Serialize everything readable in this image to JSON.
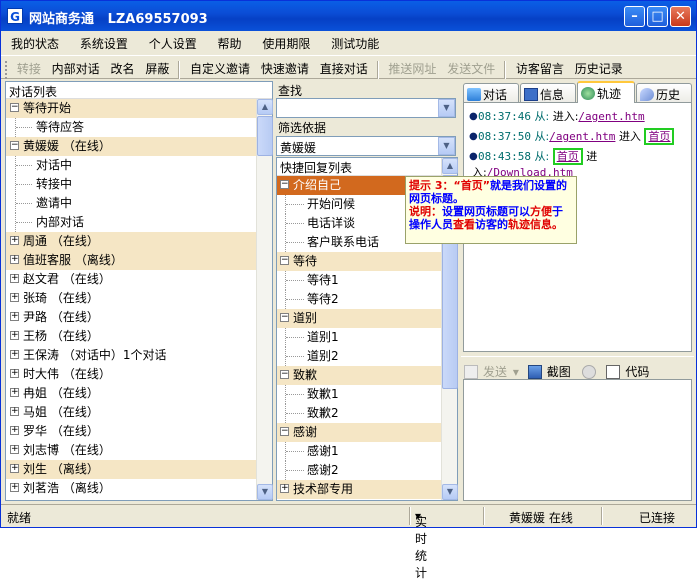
{
  "window": {
    "app_icon": "G",
    "title": "网站商务通   LZA69557093",
    "minimize_icon": "minimize-icon",
    "maximize_icon": "maximize-icon",
    "close_icon": "close-icon"
  },
  "menu": [
    "我的状态",
    "系统设置",
    "个人设置",
    "帮助",
    "使用期限",
    "测试功能"
  ],
  "toolbar": {
    "transfer": "转接",
    "internal_chat": "内部对话",
    "rename": "改名",
    "block": "屏蔽",
    "custom_invite": "自定义邀请",
    "quick_invite": "快速邀请",
    "direct_chat": "直接对话",
    "push_url": "推送网址",
    "send_file": "发送文件",
    "visitor_message": "访客留言",
    "history": "历史记录"
  },
  "left": {
    "header": "对话列表",
    "items": [
      {
        "label": "等待开始",
        "type": "group",
        "hl": true
      },
      {
        "label": "等待应答",
        "type": "child",
        "hl": false
      },
      {
        "label": "黄媛媛 （在线）",
        "type": "group",
        "hl": true
      },
      {
        "label": "对话中",
        "type": "child",
        "hl": false
      },
      {
        "label": "转接中",
        "type": "child",
        "hl": false
      },
      {
        "label": "邀请中",
        "type": "child",
        "hl": false
      },
      {
        "label": "内部对话",
        "type": "child",
        "hl": false
      },
      {
        "label": "周通 （在线）",
        "type": "group",
        "hl": true
      },
      {
        "label": "值班客服 （离线）",
        "type": "group",
        "hl": true
      },
      {
        "label": "赵文君 （在线）",
        "type": "group",
        "hl": false
      },
      {
        "label": "张琦 （在线）",
        "type": "group",
        "hl": false
      },
      {
        "label": "尹路 （在线）",
        "type": "group",
        "hl": false
      },
      {
        "label": "王杨 （在线）",
        "type": "group",
        "hl": false
      },
      {
        "label": "王保涛 （对话中）1个对话",
        "type": "group",
        "hl": false
      },
      {
        "label": "时大伟 （在线）",
        "type": "group",
        "hl": false
      },
      {
        "label": "冉姐 （在线）",
        "type": "group",
        "hl": false
      },
      {
        "label": "马姐 （在线）",
        "type": "group",
        "hl": false
      },
      {
        "label": "罗华 （在线）",
        "type": "group",
        "hl": false
      },
      {
        "label": "刘志博 （在线）",
        "type": "group",
        "hl": false
      },
      {
        "label": "刘生 （离线）",
        "type": "group",
        "hl": true
      },
      {
        "label": "刘茗浩 （离线）",
        "type": "group",
        "hl": false
      }
    ]
  },
  "middle": {
    "search_label": "查找",
    "search_value": "",
    "filter_label": "筛选依据",
    "filter_value": "黄媛媛",
    "reply_header": "快捷回复列表",
    "replies": [
      {
        "label": "介绍自己",
        "type": "group",
        "sel": true
      },
      {
        "label": "开始问候",
        "type": "child"
      },
      {
        "label": "电话详谈",
        "type": "child"
      },
      {
        "label": "客户联系电话",
        "type": "child"
      },
      {
        "label": "等待",
        "type": "group"
      },
      {
        "label": "等待1",
        "type": "child"
      },
      {
        "label": "等待2",
        "type": "child"
      },
      {
        "label": "道别",
        "type": "group"
      },
      {
        "label": "道别1",
        "type": "child"
      },
      {
        "label": "道别2",
        "type": "child"
      },
      {
        "label": "致歉",
        "type": "group"
      },
      {
        "label": "致歉1",
        "type": "child"
      },
      {
        "label": "致歉2",
        "type": "child"
      },
      {
        "label": "感谢",
        "type": "group"
      },
      {
        "label": "感谢1",
        "type": "child"
      },
      {
        "label": "感谢2",
        "type": "child"
      },
      {
        "label": "技术部专用",
        "type": "group"
      }
    ]
  },
  "right": {
    "tabs": [
      "对话",
      "信息",
      "轨迹",
      "历史"
    ],
    "active_tab": "轨迹",
    "track": [
      {
        "time": "08:37:46",
        "from": "从:",
        "action": "进入:",
        "link": "/agent.htm",
        "label": ""
      },
      {
        "time": "08:37:50",
        "from": "从:",
        "action": "进入",
        "link": "/agent.htm",
        "label": "首页"
      },
      {
        "time": "08:43:58",
        "from": "从:",
        "action": "进入:",
        "link": "/Download.htm",
        "label": "首页"
      }
    ],
    "tooltip": {
      "prefix": "提示 3：",
      "quoted": "“首页”",
      "line1": "就是我们设置的网页标题。",
      "note_label": "说明：",
      "note_a": "设置网页标题可以",
      "note_b": "方便",
      "note_c": "于操作人员",
      "note_d": "查看",
      "note_e": "访客的",
      "note_f": "轨迹信息。"
    },
    "send_bar": {
      "send": "发送",
      "screenshot": "截图",
      "code": "代码"
    }
  },
  "status": {
    "ready": "就绪",
    "stats": "实时统计",
    "user": "黄媛媛 在线",
    "connected": "已连接"
  },
  "colors": {
    "title_bar": "#0a51d9",
    "highlight_row": "#f5e6c5",
    "selected_row": "#d2691e",
    "callout_border": "#22cc22",
    "tooltip_bg": "#ffffe1"
  }
}
